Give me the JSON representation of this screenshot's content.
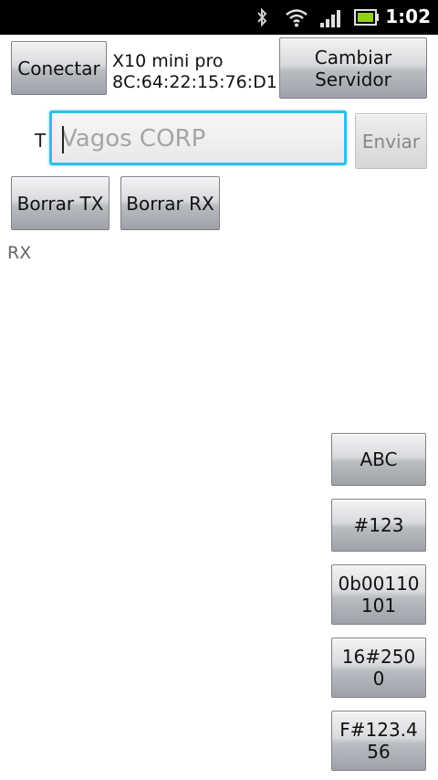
{
  "status_bar": {
    "time": "1:02",
    "icons": [
      "bluetooth-icon",
      "wifi-icon",
      "signal-icon",
      "battery-icon"
    ]
  },
  "top": {
    "connect_label": "Conectar",
    "device_name": "X10 mini pro",
    "device_address": "8C:64:22:15:76:D1",
    "change_server_label": "Cambiar\nServidor"
  },
  "send_row": {
    "t_label": "T",
    "input_placeholder": "Vagos CORP",
    "input_value": "",
    "send_label": "Enviar"
  },
  "clear": {
    "clear_tx_label": "Borrar TX",
    "clear_rx_label": "Borrar RX"
  },
  "rx_label": "RX",
  "format_buttons": [
    "ABC",
    "#123",
    "0b00110\n101",
    "16#250\n0",
    "F#123.4\n56"
  ]
}
